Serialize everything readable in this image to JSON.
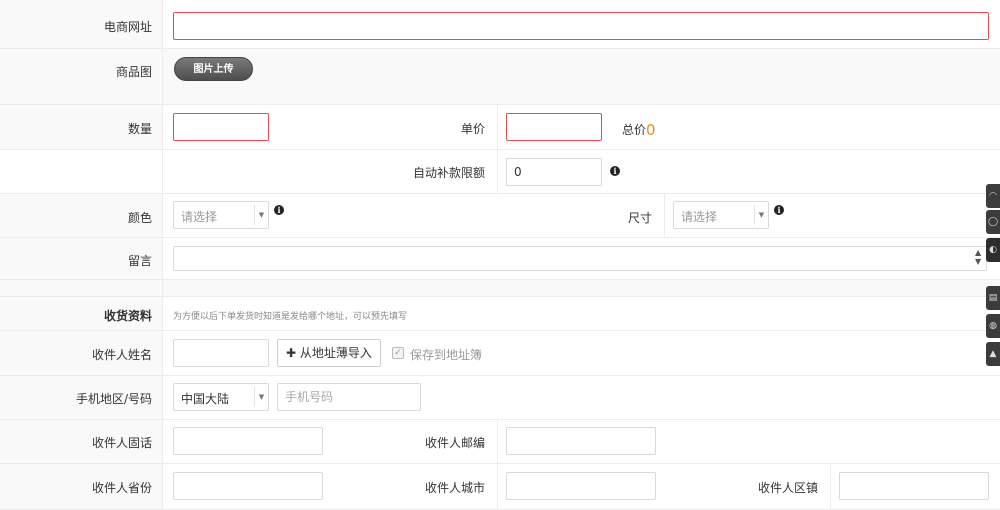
{
  "form": {
    "url_label": "电商网址",
    "image_label": "商品图",
    "upload_label": "图片上传",
    "qty_label": "数量",
    "price_label": "单价",
    "total_label": "总价",
    "total_value": "0",
    "auto_label": "自动补款限额",
    "auto_value": "0",
    "color_label": "颜色",
    "color_select": "请选择",
    "size_label": "尺寸",
    "size_select": "请选择",
    "note_label": "留言",
    "info_glyph": "i"
  },
  "shipping": {
    "section_label": "收货资料",
    "section_hint": "为方便以后下单发货时知道是发给哪个地址，可以预先填写",
    "name_label": "收件人姓名",
    "import_button": "从地址薄导入",
    "save_label": "保存到地址簿",
    "phone_label": "手机地区/号码",
    "region_select": "中国大陆",
    "phone_placeholder": "手机号码",
    "tel_label": "收件人固话",
    "zip_label": "收件人邮编",
    "province_label": "收件人省份",
    "city_label": "收件人城市",
    "district_label": "收件人区镇"
  },
  "colors": {
    "accent_orange": "#f08a1c",
    "required_border": "#d9534f"
  }
}
